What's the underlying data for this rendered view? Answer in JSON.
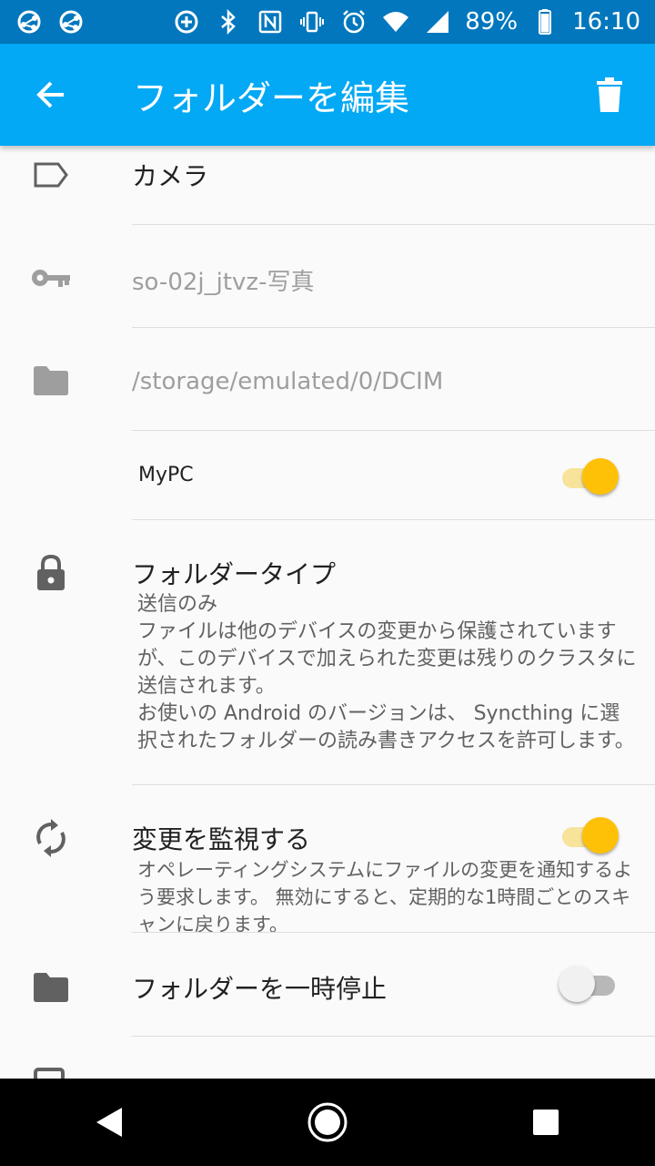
{
  "status_bar": {
    "battery": "89%",
    "time": "16:10"
  },
  "app_bar": {
    "title": "フォルダーを編集"
  },
  "settings": {
    "label": "カメラ",
    "folder_id": "so-02j_jtvz-写真",
    "folder_path": "/storage/emulated/0/DCIM",
    "device": {
      "name": "MyPC",
      "enabled": true
    },
    "folder_type": {
      "title": "フォルダータイプ",
      "value": "送信のみ",
      "description1": "ファイルは他のデバイスの変更から保護されていますが、このデバイスで加えられた変更は残りのクラスタに送信されます。",
      "description2": "お使いの Android のバージョンは、 Syncthing に選択されたフォルダーの読み書きアクセスを許可します。"
    },
    "watch_changes": {
      "title": "変更を監視する",
      "description": "オペレーティングシステムにファイルの変更を通知するよう要求します。 無効にすると、定期的な1時間ごとのスキャンに戻ります。",
      "enabled": true
    },
    "pause_folder": {
      "title": "フォルダーを一時停止",
      "enabled": false
    }
  },
  "colors": {
    "status_bar": "#0277bd",
    "app_bar": "#03a9f4",
    "switch_on": "#ffc107",
    "background": "#fafafa"
  }
}
